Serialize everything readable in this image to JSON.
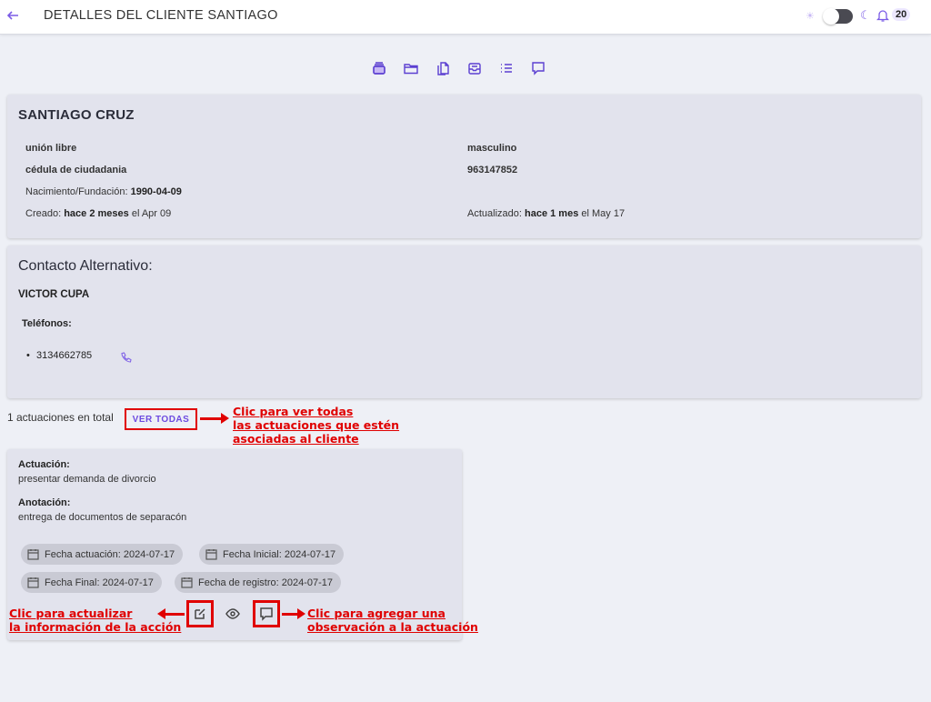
{
  "header": {
    "back_icon": "arrow-left-icon",
    "title": "DETALLES DEL CLIENTE SANTIAGO",
    "theme": {
      "light_icon": "sun-icon",
      "dark_icon": "moon-icon"
    },
    "notifications": {
      "icon": "bell-icon",
      "count": "20"
    }
  },
  "nav_icons": [
    "layers-icon",
    "folder-icon",
    "documents-icon",
    "inbox-icon",
    "list-icon",
    "chat-icon"
  ],
  "client": {
    "name": "SANTIAGO CRUZ",
    "estado_civil": "unión libre",
    "genero": "masculino",
    "tipo_documento": "cédula de ciudadania",
    "numero_documento": "963147852",
    "nacimiento_label": "Nacimiento/Fundación:",
    "nacimiento": "1990-04-09",
    "creado_label": "Creado:",
    "creado_rel": "hace 2 meses",
    "creado_fecha": "el Apr 09",
    "actualizado_label": "Actualizado:",
    "actualizado_rel": "hace 1 mes",
    "actualizado_fecha": "el May 17"
  },
  "contacto": {
    "heading": "Contacto Alternativo:",
    "nombre": "VICTOR CUPA",
    "telefonos_label": "Teléfonos:",
    "telefonos": [
      "3134662785"
    ]
  },
  "actuaciones": {
    "total_text": "1 actuaciones en total",
    "ver_todas": "VER TODAS",
    "item": {
      "actuacion_label": "Actuación:",
      "actuacion": "presentar demanda de divorcio",
      "anotacion_label": "Anotación:",
      "anotacion": "entrega de documentos de separacón",
      "chips": [
        "Fecha actuación: 2024-07-17",
        "Fecha Inicial: 2024-07-17",
        "Fecha Final: 2024-07-17",
        "Fecha de registro: 2024-07-17"
      ]
    }
  },
  "annotations": {
    "ver_todas_1": "Clic para ver todas",
    "ver_todas_2": "las actuaciones que estén",
    "ver_todas_3": "asociadas al cliente",
    "editar_1": "Clic para actualizar",
    "editar_2": "la información de la acción",
    "observacion_1": "Clic para agregar una",
    "observacion_2": "observación a la actuación"
  },
  "colors": {
    "accent": "#7b5ce6",
    "annotation": "#e00000",
    "card": "#e2e3ed",
    "background": "#eef0f6"
  }
}
